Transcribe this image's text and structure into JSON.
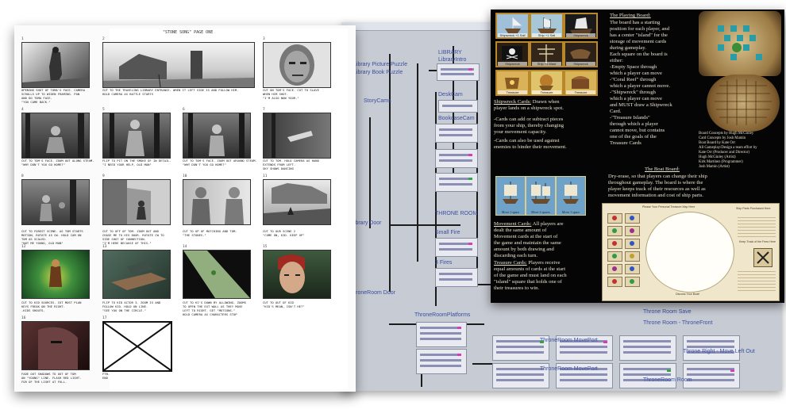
{
  "storyboard": {
    "title": "\"STONE SONG\" PAGE ONE",
    "panels": [
      {
        "num": "1",
        "caption": "OPENING SHOT OF TOMA'S FACE. CAMERA\nSCROLLS UP TO WIDEN FRAMING. PAN\nAND DO TOMA FACE.\n\"YOU CAME BACK.\""
      },
      {
        "num": "2",
        "caption": "CUT TO THE TRAVELING LIBRARY ENTRANCE. WHEN IT LEFT SIDE IS AND FOLLOW HIM.\nHOLD CAMERA AS BATTLE STARTS"
      },
      {
        "num": "3",
        "caption": "CUT ON TOM'S FACE. CUT TO SLAVE\nWHEN HIM SHOT.\n\"I'M ALSO NOW YOUR.\""
      },
      {
        "num": "4",
        "caption": "CUT TO TOM'S FACE. ZOOM OUT ALONG STEAM.\n\"WHY DON'T YOU GO HOME?\""
      },
      {
        "num": "5",
        "caption": "FLIP TO PIT ON THE SMOKE OF IN DETAIL.\n\"I NEED YOUR HELP, OLD MAN\""
      },
      {
        "num": "6",
        "caption": "CUT TO TOM'S FACE. ZOOM OUT AROUND STEAM.\n\"WHY DON'T YOU GO HOME?\""
      },
      {
        "num": "7",
        "caption": "CUT TO TOM. HOLD CAMERA AS HAND\nEXTENDS FROM LEFT.\nSKY SHOWS DANCING"
      },
      {
        "num": "8",
        "caption": "CUT TO FOREST SCENE. AS TOM STARTS\nMOTION, ROTATE 45 CW. HOLD CAM ON\nTOM AS SCALED.\n\"NOT ME YOUNG, OLD MAN\""
      },
      {
        "num": "9",
        "caption": "CUT TO OFF OF TOM. ZOOM OUT AND\nCHASE ME TO HIS DOOR. ROTATE CW TO\nSIDE SHOT OF CONNECTION.\n\"I'M HERE BECAUSE OF THIS.\""
      },
      {
        "num": "10",
        "caption": "CUT TO UP OF MATCHING AND TOM.\n\"THE STONES.\""
      },
      {
        "num": "11",
        "caption": "CUT TO OUR SCENE 2\n\"COME ON, KID. KEEP UP\""
      },
      {
        "num": "12",
        "caption": "CUT TO KID SOURCES. CUT MOST PLAN\nKEYS FREAK ON THE RIGHT.\n-KIDS SHOUTS-"
      },
      {
        "num": "13",
        "caption": "FLIP TO KID ACTOR 3. ZOOM IS AND\nFOLLOW KID. HOLD ON LINE.\n\"SEE YOU ON THE CIRCLE.\""
      },
      {
        "num": "14",
        "caption": "CUT TO KI'S DOWN BY ALLOWING. ZOOMS\nTO OPEN THE EXT WALL AS THEY MOVE\nLEFT TO RIGHT. GET \"MOTIONS.\"\nHOLD CAMERA AS CHARACTERS STOP"
      },
      {
        "num": "15",
        "caption": "CUT TO OUT OF KID\n\"KID'S MEAN, ISN'T HE?\""
      },
      {
        "num": "16",
        "caption": "FADE OUT SHADOWS TO OUT OF TOM\nON \"YOUNG\" LINE. FLASH RED LIGHT.\nFOR OF THE LIGHT AT FULL."
      },
      {
        "num": "17",
        "caption": "FTB.\nEND"
      }
    ]
  },
  "graph_editor": {
    "nodes": [
      "Library Picture Puzzle",
      "Library Book Puzzle",
      "LIBRARY",
      "StoryCams",
      "DeskCam",
      "BookcaseCam",
      "Library Door",
      "THRONE ROOM",
      "Small Fire",
      "3 Fires",
      "ThroneRoom Door",
      "ThroneRoomPlatforms",
      "LibraryIntro"
    ],
    "bottom_nodes": [
      "ThroneRoom MovePort",
      "ThroneRoom MovePort",
      "Throne Room Save",
      "Throne Room - ThroneFront",
      "Throne Right - Move Left Out",
      "ThroneRoom Room"
    ]
  },
  "board_game": {
    "playing_board": {
      "heading": "The Playing Board:",
      "body": "The board has a starting\nposition for each player, and\nhas a center \"island\" for the\nstorage of movement cards\nduring gameplay.\nEach square on the board is\neither:\n  -Empty Space through\n  which a player can move\n  -\"Coral Reef\" through\n  which a player cannot move.\n  -\"Shipwreck\" through\n  which a player can move\n  and MUST draw a Shipwreck\n  Card.\n  -\"Treasure Islands\"\n  through which a player\n  cannot move, but contains\n  one of the goals of the\n  Treasure Cards"
    },
    "shipwreck_cards": {
      "heading": "Shipwreck Cards:",
      "intro": " Drawn when\nplayer lands on a shipwreck spot.",
      "p1": "-Cards can add or subtract pieces\nfrom your ship, thereby changing\nyour movement capacity.",
      "p2": "-Cards can also be used against\nenemies to hinder their movement."
    },
    "movement_cards": {
      "heading": "Movement Cards:",
      "body": " All players are\ndealt the same amount of\nMovement cards at the start of\nthe game and maintain the same\namount by both drawing and\ndiscarding each turn."
    },
    "treasure_cards": {
      "heading": "Treasure Cards:",
      "body": " Players receive\nequal amounts of cards at the start\nof the game and must land on each\n\"island\" square that holds one of\ntheir treasures to win."
    },
    "credits": "Board Concepts by Hugh McGinley\nCard Concepts by Josh Mamin\nBoat Board by Kate Orr\nAll Gameplay/Design a team effort by\n  Kate Orr (Producer and Director)\n  Hugh McGinley (Artist)\n  Kirk Martinez (Programmer)\n  Josh Mamin (Artist)",
    "boat_board": {
      "heading": "The Boat Board:",
      "body": "Dry-erase, so that players can change their ship\nthroughout gameplay.  The board is where the\nplayer keeps track of their resources as well as\nmovement information and cost of ship parts."
    },
    "cards": [
      {
        "label": "Shipwreck +1 Sail"
      },
      {
        "label": "Ship +1 Sail"
      },
      {
        "label": "Shipwreck"
      },
      {
        "label": "Shipwreck"
      },
      {
        "label": "Ship +1 Mast"
      },
      {
        "label": "Shipwreck"
      },
      {
        "label": "Treasure"
      },
      {
        "label": "Treasure"
      },
      {
        "label": "Treasure"
      }
    ],
    "movement_card_labels": [
      "Move 1 space",
      "Move 2 spaces",
      "Move 1 space"
    ],
    "boat_sheet": {
      "top": "Please Your Personal Treasure Map Here",
      "ship_parts_title": "Ship Parts Purchased Here",
      "footer": "Discuss Your Boat!",
      "track": "Keep Track of the Fees Here"
    },
    "colors": {
      "board_bg": "#050505",
      "board_text": "#e9e2cc",
      "card_border": "#b8872a",
      "sheet": "#efe6cc"
    }
  }
}
